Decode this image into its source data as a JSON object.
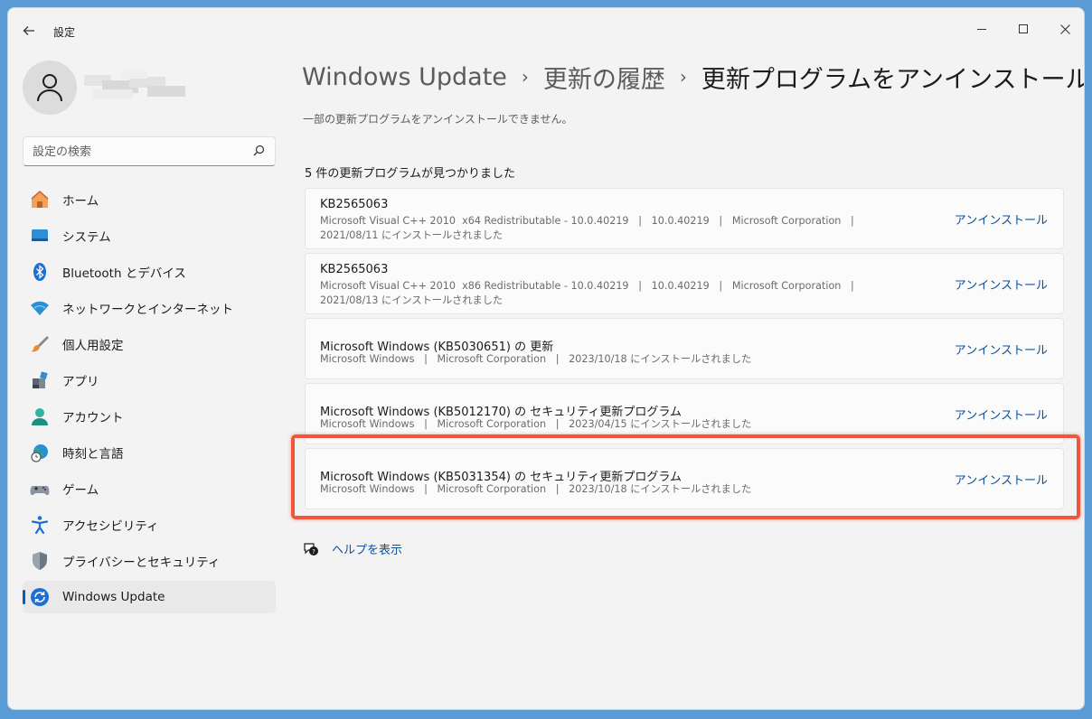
{
  "window": {
    "title": "設定"
  },
  "sidebar": {
    "search_placeholder": "設定の検索",
    "items": [
      {
        "label": "ホーム",
        "icon": "home-icon"
      },
      {
        "label": "システム",
        "icon": "system-icon"
      },
      {
        "label": "Bluetooth とデバイス",
        "icon": "bluetooth-icon"
      },
      {
        "label": "ネットワークとインターネット",
        "icon": "network-icon"
      },
      {
        "label": "個人用設定",
        "icon": "personalization-brush-icon"
      },
      {
        "label": "アプリ",
        "icon": "apps-icon"
      },
      {
        "label": "アカウント",
        "icon": "account-icon"
      },
      {
        "label": "時刻と言語",
        "icon": "time-language-icon"
      },
      {
        "label": "ゲーム",
        "icon": "gaming-icon"
      },
      {
        "label": "アクセシビリティ",
        "icon": "accessibility-icon"
      },
      {
        "label": "プライバシーとセキュリティ",
        "icon": "privacy-shield-icon"
      },
      {
        "label": "Windows Update",
        "icon": "windows-update-icon",
        "active": true
      }
    ]
  },
  "breadcrumb": {
    "items": [
      "Windows Update",
      "更新の履歴",
      "更新プログラムをアンインストールする"
    ],
    "separator": "›"
  },
  "subtitle": "一部の更新プログラムをアンインストールできません。",
  "count_label": "5 件の更新プログラムが見つかりました",
  "updates": [
    {
      "name": "KB2565063",
      "meta_line1": "Microsoft Visual C++ 2010  x64 Redistributable - 10.0.40219   |   10.0.40219   |   Microsoft Corporation   |",
      "meta_line2": "2021/08/11 にインストールされました",
      "action": "アンインストール"
    },
    {
      "name": "KB2565063",
      "meta_line1": "Microsoft Visual C++ 2010  x86 Redistributable - 10.0.40219   |   10.0.40219   |   Microsoft Corporation   |",
      "meta_line2": "2021/08/13 にインストールされました",
      "action": "アンインストール"
    },
    {
      "name": "Microsoft Windows (KB5030651) の 更新",
      "meta_line1": "Microsoft Windows   |   Microsoft Corporation   |   2023/10/18 にインストールされました",
      "action": "アンインストール"
    },
    {
      "name": "Microsoft Windows (KB5012170) の セキュリティ更新プログラム",
      "meta_line1": "Microsoft Windows   |   Microsoft Corporation   |   2023/04/15 にインストールされました",
      "action": "アンインストール"
    },
    {
      "name": "Microsoft Windows (KB5031354) の セキュリティ更新プログラム",
      "meta_line1": "Microsoft Windows   |   Microsoft Corporation   |   2023/10/18 にインストールされました",
      "action": "アンインストール",
      "highlighted": true
    }
  ],
  "help": {
    "label": "ヘルプを表示"
  },
  "colors": {
    "accent": "#005fb8",
    "link": "#0a4f9e",
    "highlight": "#f2553c"
  }
}
